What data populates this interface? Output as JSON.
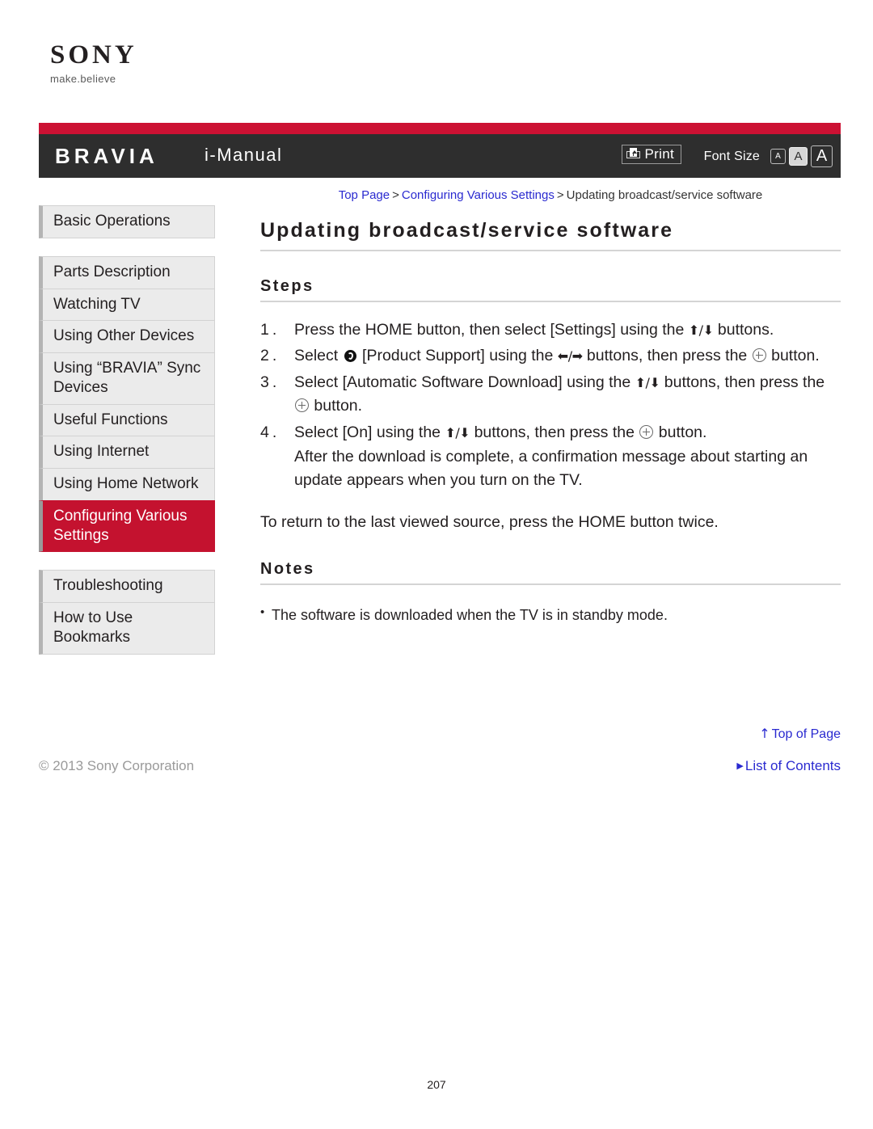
{
  "brand": {
    "logo_wordmark": "SONY",
    "logo_tagline": "make.believe"
  },
  "header": {
    "product": "BRAVIA",
    "manual": "i-Manual",
    "print_label": "Print",
    "print_icon": "printer-icon",
    "font_size_label": "Font Size",
    "font_size_options": [
      {
        "glyph": "A",
        "size": "small",
        "selected": false
      },
      {
        "glyph": "A",
        "size": "medium",
        "selected": true
      },
      {
        "glyph": "A",
        "size": "large",
        "selected": false
      }
    ],
    "colors": {
      "accent_red": "#cc1133",
      "bar_dark": "#2e2e2e"
    }
  },
  "sidebar": {
    "groups": [
      {
        "items": [
          {
            "label": "Basic Operations",
            "active": false
          }
        ]
      },
      {
        "items": [
          {
            "label": "Parts Description",
            "active": false
          },
          {
            "label": "Watching TV",
            "active": false
          },
          {
            "label": "Using Other Devices",
            "active": false
          },
          {
            "label": "Using “BRAVIA” Sync Devices",
            "active": false
          },
          {
            "label": "Useful Functions",
            "active": false
          },
          {
            "label": "Using Internet",
            "active": false
          },
          {
            "label": "Using Home Network",
            "active": false
          },
          {
            "label": "Configuring Various Settings",
            "active": true
          }
        ]
      },
      {
        "items": [
          {
            "label": "Troubleshooting",
            "active": false
          },
          {
            "label": "How to Use Bookmarks",
            "active": false
          }
        ]
      }
    ],
    "active_color": "#c4122f"
  },
  "breadcrumb": {
    "items": [
      {
        "label": "Top Page",
        "link": true
      },
      {
        "label": "Configuring Various Settings",
        "link": true
      },
      {
        "label": "Updating broadcast/service software",
        "link": false
      }
    ],
    "separator": ">",
    "link_color": "#2a2ad0"
  },
  "main": {
    "page_title": "Updating broadcast/service software",
    "steps_heading": "Steps",
    "steps": [
      {
        "number": "1.",
        "parts": [
          {
            "t": "text",
            "v": "Press the HOME button, then select [Settings] using the "
          },
          {
            "t": "arrow-ud",
            "v": "⬆/⬇"
          },
          {
            "t": "text",
            "v": " buttons."
          }
        ]
      },
      {
        "number": "2.",
        "parts": [
          {
            "t": "text",
            "v": "Select "
          },
          {
            "t": "support-icon",
            "v": "product-support-icon"
          },
          {
            "t": "text",
            "v": " [Product Support] using the "
          },
          {
            "t": "arrow-lr",
            "v": "⬅/➡"
          },
          {
            "t": "text",
            "v": " buttons, then press the "
          },
          {
            "t": "circle-plus",
            "v": "circle-plus-icon"
          },
          {
            "t": "text",
            "v": " button."
          }
        ]
      },
      {
        "number": "3.",
        "parts": [
          {
            "t": "text",
            "v": "Select [Automatic Software Download] using the "
          },
          {
            "t": "arrow-ud",
            "v": "⬆/⬇"
          },
          {
            "t": "text",
            "v": " buttons, then press the "
          },
          {
            "t": "circle-plus",
            "v": "circle-plus-icon"
          },
          {
            "t": "text",
            "v": " button."
          }
        ]
      },
      {
        "number": "4.",
        "parts": [
          {
            "t": "text",
            "v": "Select [On] using the "
          },
          {
            "t": "arrow-ud",
            "v": "⬆/⬇"
          },
          {
            "t": "text",
            "v": " buttons, then press the "
          },
          {
            "t": "circle-plus",
            "v": "circle-plus-icon"
          },
          {
            "t": "text",
            "v": " button."
          },
          {
            "t": "break",
            "v": ""
          },
          {
            "t": "text",
            "v": "After the download is complete, a confirmation message about starting an update appears when you turn on the TV."
          }
        ]
      }
    ],
    "closing_text": "To return to the last viewed source, press the HOME button twice.",
    "notes_heading": "Notes",
    "notes": [
      "The software is downloaded when the TV is in standby mode."
    ]
  },
  "footer": {
    "top_of_page": "Top of Page",
    "top_of_page_icon": "up-arrow-icon",
    "copyright": "© 2013 Sony Corporation",
    "list_of_contents": "List of Contents",
    "list_of_contents_icon": "triangle-right-icon",
    "page_number": "207"
  }
}
